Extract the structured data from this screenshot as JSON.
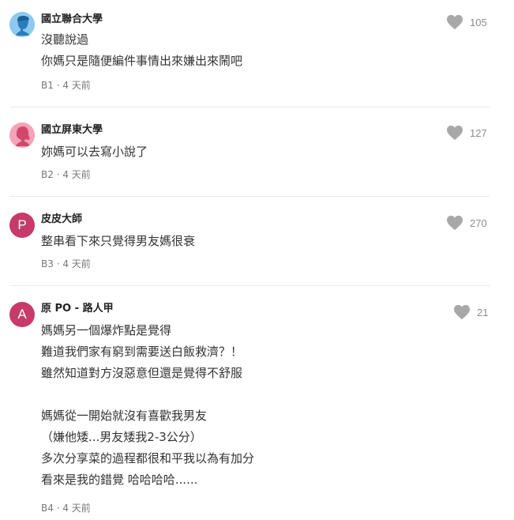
{
  "comments": [
    {
      "author": "國立聯合大學",
      "lines": [
        "沒聽說過",
        "你媽只是隨便編件事情出來嫌出來鬧吧"
      ],
      "floor": "B1",
      "time": "4 天前",
      "likes": "105",
      "avatar": {
        "type": "school-male",
        "color": "#8ec9ef"
      }
    },
    {
      "author": "國立屏東大學",
      "lines": [
        "妳媽可以去寫小說了"
      ],
      "floor": "B2",
      "time": "4 天前",
      "likes": "127",
      "avatar": {
        "type": "school-female",
        "color": "#f5a3b8"
      }
    },
    {
      "author": "皮皮大師",
      "lines": [
        "整串看下來只覺得男友媽很衰"
      ],
      "floor": "B3",
      "time": "4 天前",
      "likes": "270",
      "avatar": {
        "type": "letter",
        "letter": "P",
        "color": "#c73a6a"
      }
    },
    {
      "author_prefix": "原 PO",
      "author": "路人甲",
      "lines": [
        "媽媽另一個爆炸點是覺得",
        "難道我們家有窮到需要送白飯救濟？！",
        "雖然知道對方沒惡意但還是覺得不舒服",
        "",
        "媽媽從一開始就沒有喜歡我男友",
        "（嫌他矮...男友矮我2-3公分）",
        "多次分享菜的過程都很和平我以為有加分",
        "看來是我的錯覺 哈哈哈哈......"
      ],
      "floor": "B4",
      "time": "4 天前",
      "likes": "21",
      "avatar": {
        "type": "letter",
        "letter": "A",
        "color": "#c73a6a"
      }
    }
  ],
  "icons": {
    "like": "heart-icon"
  },
  "colors": {
    "like_icon": "#a8a8a8",
    "divider": "#e8e8e8"
  }
}
